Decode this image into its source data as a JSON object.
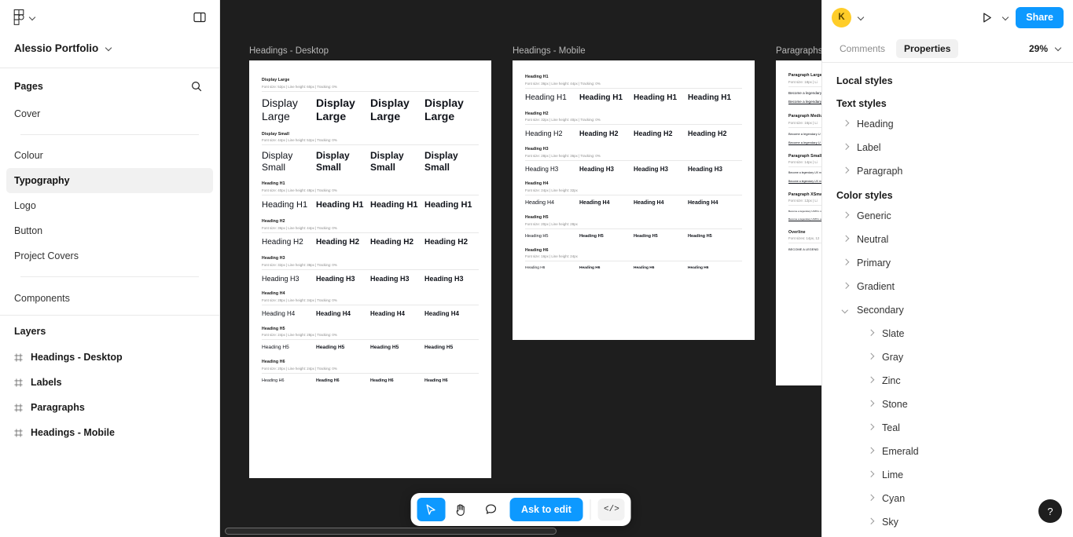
{
  "left_panel": {
    "file_name": "Alessio Portfolio",
    "pages_label": "Pages",
    "pages": [
      {
        "label": "Cover",
        "selected": false
      },
      {
        "label": "Colour",
        "selected": false
      },
      {
        "label": "Typography",
        "selected": true
      },
      {
        "label": "Logo",
        "selected": false
      },
      {
        "label": "Button",
        "selected": false
      },
      {
        "label": "Project Covers",
        "selected": false
      }
    ],
    "components_label": "Components",
    "layers_label": "Layers",
    "layers": [
      {
        "label": "Headings - Desktop"
      },
      {
        "label": "Labels"
      },
      {
        "label": "Paragraphs"
      },
      {
        "label": "Headings - Mobile"
      }
    ]
  },
  "canvas": {
    "zoom": "29%",
    "frames": [
      {
        "label": "Headings - Desktop",
        "groups": [
          {
            "title": "Display Large",
            "meta": "Font size: 52px | Line height: 60px | Tracking: 0%",
            "samples": [
              "Display\nLarge",
              "Display\nLarge",
              "Display\nLarge",
              "Display\nLarge"
            ],
            "size": 14
          },
          {
            "title": "Display Small",
            "meta": "Font size: 44px | Line height: 52px | Tracking: 0%",
            "samples": [
              "Display\nSmall",
              "Display\nSmall",
              "Display\nSmall",
              "Display\nSmall"
            ],
            "size": 12
          },
          {
            "title": "Heading H1",
            "meta": "Font size: 40px | Line height: 48px | Tracking: 0%",
            "samples": [
              "Heading H1",
              "Heading H1",
              "Heading H1",
              "Heading H1"
            ],
            "size": 11
          },
          {
            "title": "Heading H2",
            "meta": "Font size: 36px | Line height: 44px | Tracking: 0%",
            "samples": [
              "Heading H2",
              "Heading H2",
              "Heading H2",
              "Heading H2"
            ],
            "size": 10
          },
          {
            "title": "Heading H3",
            "meta": "Font size: 32px | Line height: 38px | Tracking: 0%",
            "samples": [
              "Heading H3",
              "Heading H3",
              "Heading H3",
              "Heading H3"
            ],
            "size": 9
          },
          {
            "title": "Heading H4",
            "meta": "Font size: 28px | Line height: 34px | Tracking: 0%",
            "samples": [
              "Heading H4",
              "Heading H4",
              "Heading H4",
              "Heading H4"
            ],
            "size": 8
          },
          {
            "title": "Heading H5",
            "meta": "Font size: 24px | Line height: 28px | Tracking: 0%",
            "samples": [
              "Heading H5",
              "Heading H5",
              "Heading H5",
              "Heading H5"
            ],
            "size": 6.6
          },
          {
            "title": "Heading H6",
            "meta": "Font size: 20px | Line height: 24px | Tracking: 0%",
            "samples": [
              "Heading H6",
              "Heading H6",
              "Heading H6",
              "Heading H6"
            ],
            "size": 5.4
          }
        ]
      },
      {
        "label": "Headings - Mobile",
        "groups": [
          {
            "title": "Heading H1",
            "meta": "Font size: 36px | Line height: 44px | Tracking: 0%",
            "samples": [
              "Heading H1",
              "Heading H1",
              "Heading H1",
              "Heading H1"
            ],
            "size": 10
          },
          {
            "title": "Heading H2",
            "meta": "Font size: 32px | Line height: 40px | Tracking: 0%",
            "samples": [
              "Heading H2",
              "Heading H2",
              "Heading H2",
              "Heading H2"
            ],
            "size": 9
          },
          {
            "title": "Heading H3",
            "meta": "Font size: 28px | Line height: 36px | Tracking: 0%",
            "samples": [
              "Heading H3",
              "Heading H3",
              "Heading H3",
              "Heading H3"
            ],
            "size": 8
          },
          {
            "title": "Heading H4",
            "meta": "Font size: 24px | Line height: 32px",
            "samples": [
              "Heading H4",
              "Heading H4",
              "Heading H4",
              "Heading H4"
            ],
            "size": 7
          },
          {
            "title": "Heading H5",
            "meta": "Font size: 20px | Line height: 28px",
            "samples": [
              "Heading H5",
              "Heading H5",
              "Heading H5",
              "Heading H5"
            ],
            "size": 5.6
          },
          {
            "title": "Heading H6",
            "meta": "Font size: 16px | Line height: 24px",
            "samples": [
              "Heading H6",
              "Heading H6",
              "Heading H6",
              "Heading H6"
            ],
            "size": 4.8
          }
        ]
      },
      {
        "label": "Paragraphs",
        "groups": [
          {
            "title": "Paragraph Large",
            "meta": "Font size: 18px | Li",
            "samples": [],
            "size": 0,
            "paragraphs": [
              {
                "text": "Become a legendary\nthrough real world\ncourses.",
                "underline": false,
                "size": 4.6
              },
              {
                "text": "Become a legendary\nthrough real world\ncourses.",
                "underline": true,
                "size": 4.6
              }
            ]
          },
          {
            "title": "Paragraph Medium",
            "meta": "Font size: 16px | Li",
            "samples": [],
            "size": 0,
            "paragraphs": [
              {
                "text": "Become a legendary U\nthrough real workfor",
                "underline": false,
                "size": 4.0
              },
              {
                "text": "Become a legendary U\nthrough real workfor",
                "underline": true,
                "size": 4.0
              }
            ]
          },
          {
            "title": "Paragraph Small",
            "meta": "Font size: 14px | Li",
            "samples": [],
            "size": 0,
            "paragraphs": [
              {
                "text": "Become a legendary UX\nmethods/practical cour",
                "underline": false,
                "size": 3.5
              },
              {
                "text": "Become a legendary UX\nmethods/practical cour",
                "underline": true,
                "size": 3.5
              }
            ]
          },
          {
            "title": "Paragraph XSmall",
            "meta": "Font size: 12px | Li",
            "samples": [],
            "size": 0,
            "paragraphs": [
              {
                "text": "Become a legendary UX/Pro\nnetwork and realise sour",
                "underline": false,
                "size": 3.1
              },
              {
                "text": "Become a legendary UX/Pro\nand/to/courses.",
                "underline": true,
                "size": 3.1
              }
            ]
          },
          {
            "title": "Overline",
            "meta": "Font sizes: 14px, 12",
            "samples": [],
            "size": 0,
            "paragraphs": [
              {
                "text": "BECOME A LEGEND",
                "underline": false,
                "size": 4.0
              }
            ]
          }
        ]
      }
    ]
  },
  "toolbar": {
    "cursor_tool": "Move",
    "hand_tool": "Hand tool",
    "comment_tool": "Add comment",
    "ask_to_edit_label": "Ask to edit",
    "code_label": "</>"
  },
  "right_panel": {
    "avatar_initial": "K",
    "share_label": "Share",
    "tabs": [
      {
        "label": "Comments",
        "active": false
      },
      {
        "label": "Properties",
        "active": true
      }
    ],
    "zoom": "29%",
    "local_styles_label": "Local styles",
    "text_styles_label": "Text styles",
    "text_styles": [
      {
        "label": "Heading",
        "expanded": false
      },
      {
        "label": "Label",
        "expanded": false
      },
      {
        "label": "Paragraph",
        "expanded": false
      }
    ],
    "color_styles_label": "Color styles",
    "color_styles": [
      {
        "label": "Generic",
        "expanded": false
      },
      {
        "label": "Neutral",
        "expanded": false
      },
      {
        "label": "Primary",
        "expanded": false
      },
      {
        "label": "Gradient",
        "expanded": false
      },
      {
        "label": "Secondary",
        "expanded": true
      }
    ],
    "secondary_children": [
      {
        "label": "Slate"
      },
      {
        "label": "Gray"
      },
      {
        "label": "Zinc"
      },
      {
        "label": "Stone"
      },
      {
        "label": "Teal"
      },
      {
        "label": "Emerald"
      },
      {
        "label": "Lime"
      },
      {
        "label": "Cyan"
      },
      {
        "label": "Sky"
      }
    ],
    "help_label": "?"
  },
  "colors": {
    "accent": "#0d99ff",
    "avatar": "#ffcd29",
    "canvas_bg": "#1e1e1e",
    "panel_bg": "#ffffff"
  }
}
